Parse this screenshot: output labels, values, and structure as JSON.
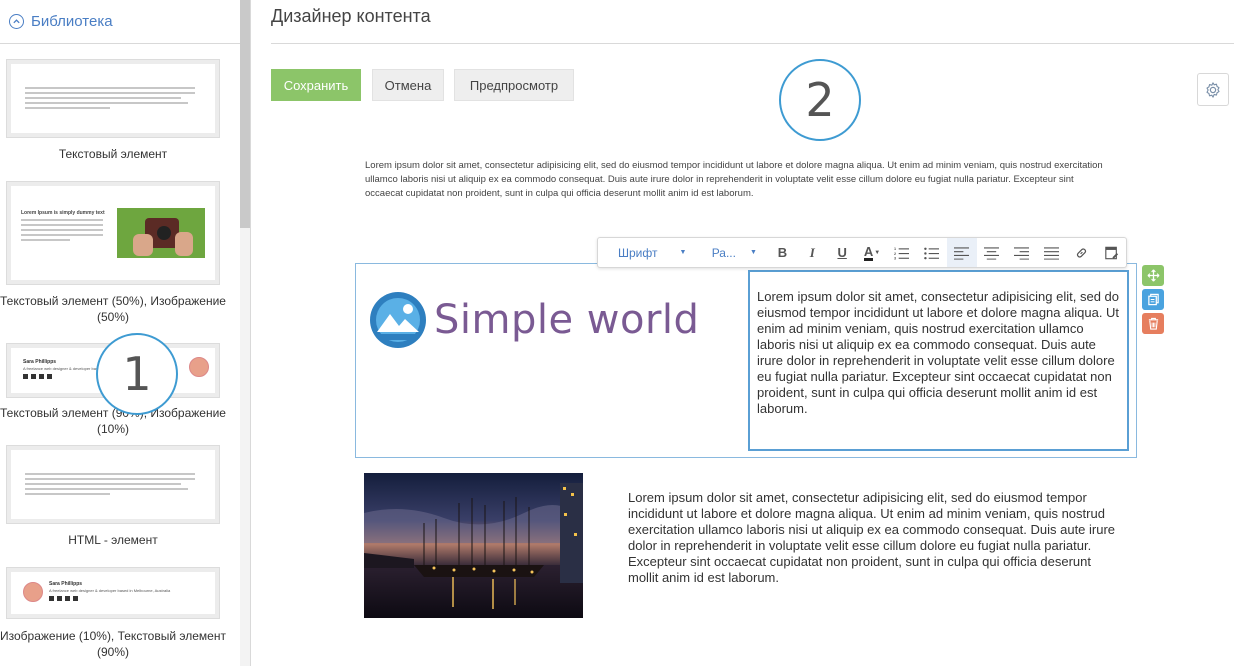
{
  "sidebar": {
    "title": "Библиотека",
    "tiles": [
      {
        "label": "Текстовый элемент"
      },
      {
        "label": "Текстовый элемент (50%), Изображение (50%)",
        "heading": "Lorem Ipsum is simply dummy text"
      },
      {
        "label": "Текстовый элемент (90%), Изображение (10%)",
        "name": "Sara Phillipps",
        "subtitle": "A freelance web designer & developer based in Melbourne, Australia"
      },
      {
        "label": "HTML - элемент"
      },
      {
        "label": "Изображение (10%), Текстовый элемент (90%)",
        "name": "Sara Phillipps",
        "subtitle": "A freelance web designer & developer based in Melbourne, Australia"
      }
    ]
  },
  "header": {
    "title": "Дизайнер контента"
  },
  "toolbar_buttons": {
    "save": "Сохранить",
    "cancel": "Отмена",
    "preview": "Предпросмотр"
  },
  "callouts": {
    "one": "1",
    "two": "2"
  },
  "content": {
    "top_paragraph": "Lorem ipsum dolor sit amet, consectetur adipisicing elit, sed do eiusmod tempor incididunt ut labore et dolore magna aliqua. Ut enim ad minim veniam, quis nostrud exercitation ullamco laboris nisi ut aliquip ex ea commodo consequat. Duis aute irure dolor in reprehenderit in voluptate velit esse cillum dolore eu fugiat nulla pariatur. Excepteur sint occaecat cupidatat non proident, sunt in culpa qui officia deserunt mollit anim id est laborum.",
    "logo_text": "Simple world",
    "selected_text": "Lorem ipsum dolor sit amet, consectetur adipisicing elit, sed do eiusmod tempor incididunt ut labore et dolore magna aliqua. Ut enim ad minim veniam, quis nostrud exercitation ullamco laboris nisi ut aliquip ex ea commodo consequat. Duis aute irure dolor in reprehenderit in voluptate velit esse cillum dolore eu fugiat nulla pariatur. Excepteur sint occaecat cupidatat non proident, sunt in culpa qui officia deserunt mollit anim id est laborum.",
    "bottom_paragraph": "Lorem ipsum dolor sit amet, consectetur adipisicing elit, sed do eiusmod tempor incididunt ut labore et dolore magna aliqua. Ut enim ad minim veniam, quis nostrud exercitation ullamco laboris nisi ut aliquip ex ea commodo consequat. Duis aute irure dolor in reprehenderit in voluptate velit esse cillum dolore eu fugiat nulla pariatur. Excepteur sint occaecat cupidatat non proident, sunt in culpa qui officia deserunt mollit anim id est laborum."
  },
  "rte": {
    "font_select": "Шрифт",
    "size_select": "Ра...",
    "bold": "B",
    "italic": "I",
    "underline": "U",
    "font_color": "A",
    "icons": [
      "bold-icon",
      "italic-icon",
      "underline-icon",
      "font-color-icon",
      "ordered-list-icon",
      "bullet-list-icon",
      "align-left-icon",
      "align-center-icon",
      "align-right-icon",
      "align-justify-icon",
      "link-icon",
      "edit-source-icon"
    ]
  },
  "colors": {
    "accent": "#4a7ec4",
    "save": "#8cc569",
    "callout": "#3e9bd2",
    "move": "#8cc569",
    "copy": "#4aa3df",
    "delete": "#e67e5e",
    "logo": "#7a5a93"
  }
}
